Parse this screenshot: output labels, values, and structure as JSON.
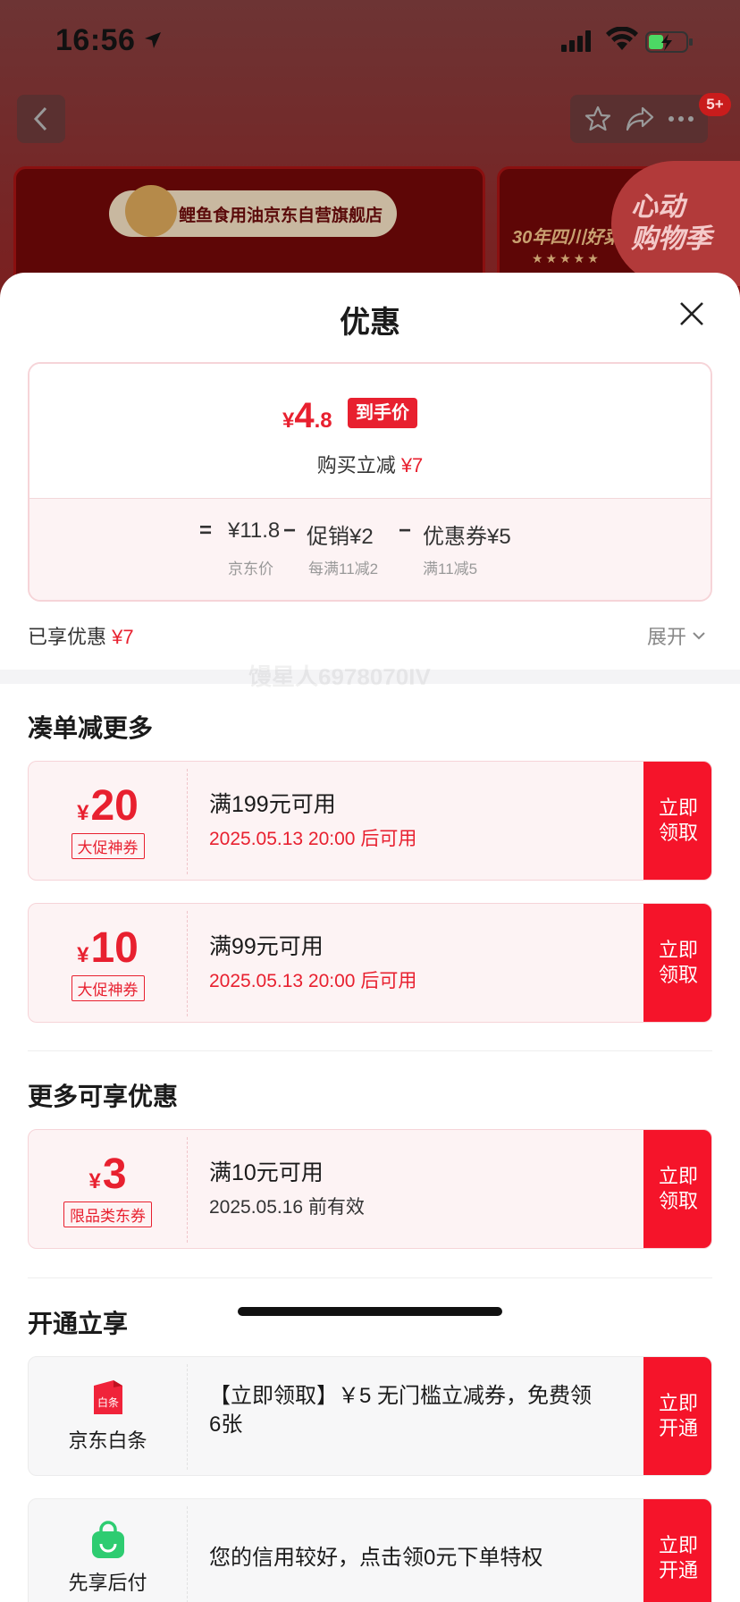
{
  "status_bar": {
    "time": "16:56"
  },
  "nav": {
    "badge": "5+"
  },
  "background": {
    "store_name": "鲤鱼食用油京东自营旗舰店",
    "card2_text": "30年四川好菜",
    "card2_stars": "★★★★★",
    "promo_line1": "心动",
    "promo_line2": "购物季"
  },
  "sheet": {
    "title": "优惠",
    "price": {
      "symbol": "¥",
      "integer": "4",
      "decimal": ".8",
      "tag": "到手价"
    },
    "buy_reduce": {
      "label": "购买立减 ",
      "amount": "¥7"
    },
    "calc": {
      "eq": "=",
      "jd_price": "¥11.8",
      "jd_price_label": "京东价",
      "minus1": "−",
      "promo": "促销¥2",
      "promo_label": "每满11减2",
      "minus2": "−",
      "coupon": "优惠券¥5",
      "coupon_label": "满11减5"
    },
    "enjoyed": {
      "label": "已享优惠 ",
      "amount": "¥7"
    },
    "expand_label": "展开",
    "watermark": "馒星人6978070IV",
    "sections": {
      "more_reduce": "凑单减更多",
      "more_offers": "更多可享优惠",
      "open_enjoy": "开通立享"
    },
    "coupons": [
      {
        "symbol": "¥",
        "amount": "20",
        "tag": "大促神券",
        "condition": "满199元可用",
        "validity": "2025.05.13 20:00 后可用",
        "action": "立即领取"
      },
      {
        "symbol": "¥",
        "amount": "10",
        "tag": "大促神券",
        "condition": "满99元可用",
        "validity": "2025.05.13 20:00 后可用",
        "action": "立即领取"
      },
      {
        "symbol": "¥",
        "amount": "3",
        "tag": "限品类东券",
        "condition": "满10元可用",
        "validity": "2025.05.16 前有效",
        "action": "立即领取"
      }
    ],
    "services": [
      {
        "name": "京东白条",
        "logo_text": "白条",
        "desc": "【立即领取】￥5 无门槛立减券，免费领6张",
        "action": "立即开通"
      },
      {
        "name": "先享后付",
        "desc": "您的信用较好，点击领0元下单特权",
        "action": "立即开通"
      }
    ]
  }
}
